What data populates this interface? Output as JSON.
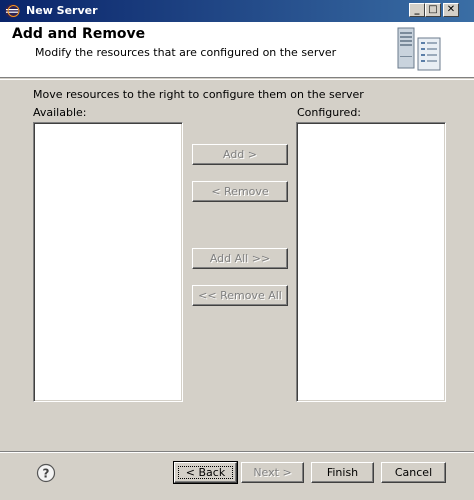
{
  "window": {
    "title": "New Server"
  },
  "titlebar": {
    "minimize": "_",
    "maximize": "□",
    "close": "✕"
  },
  "header": {
    "title": "Add and Remove",
    "description": "Modify the resources that are configured on the server"
  },
  "main": {
    "instruction": "Move resources to the right to configure them on the server",
    "available_label": "Available:",
    "configured_label": "Configured:",
    "buttons": {
      "add": "Add >",
      "remove": "< Remove",
      "add_all": "Add All >>",
      "remove_all": "<< Remove All"
    }
  },
  "footer": {
    "back": "< Back",
    "next": "Next >",
    "finish": "Finish",
    "cancel": "Cancel"
  },
  "icons": {
    "window": "eclipse-server-icon",
    "help": "help-icon",
    "banner": "server-wizard-graphic"
  }
}
